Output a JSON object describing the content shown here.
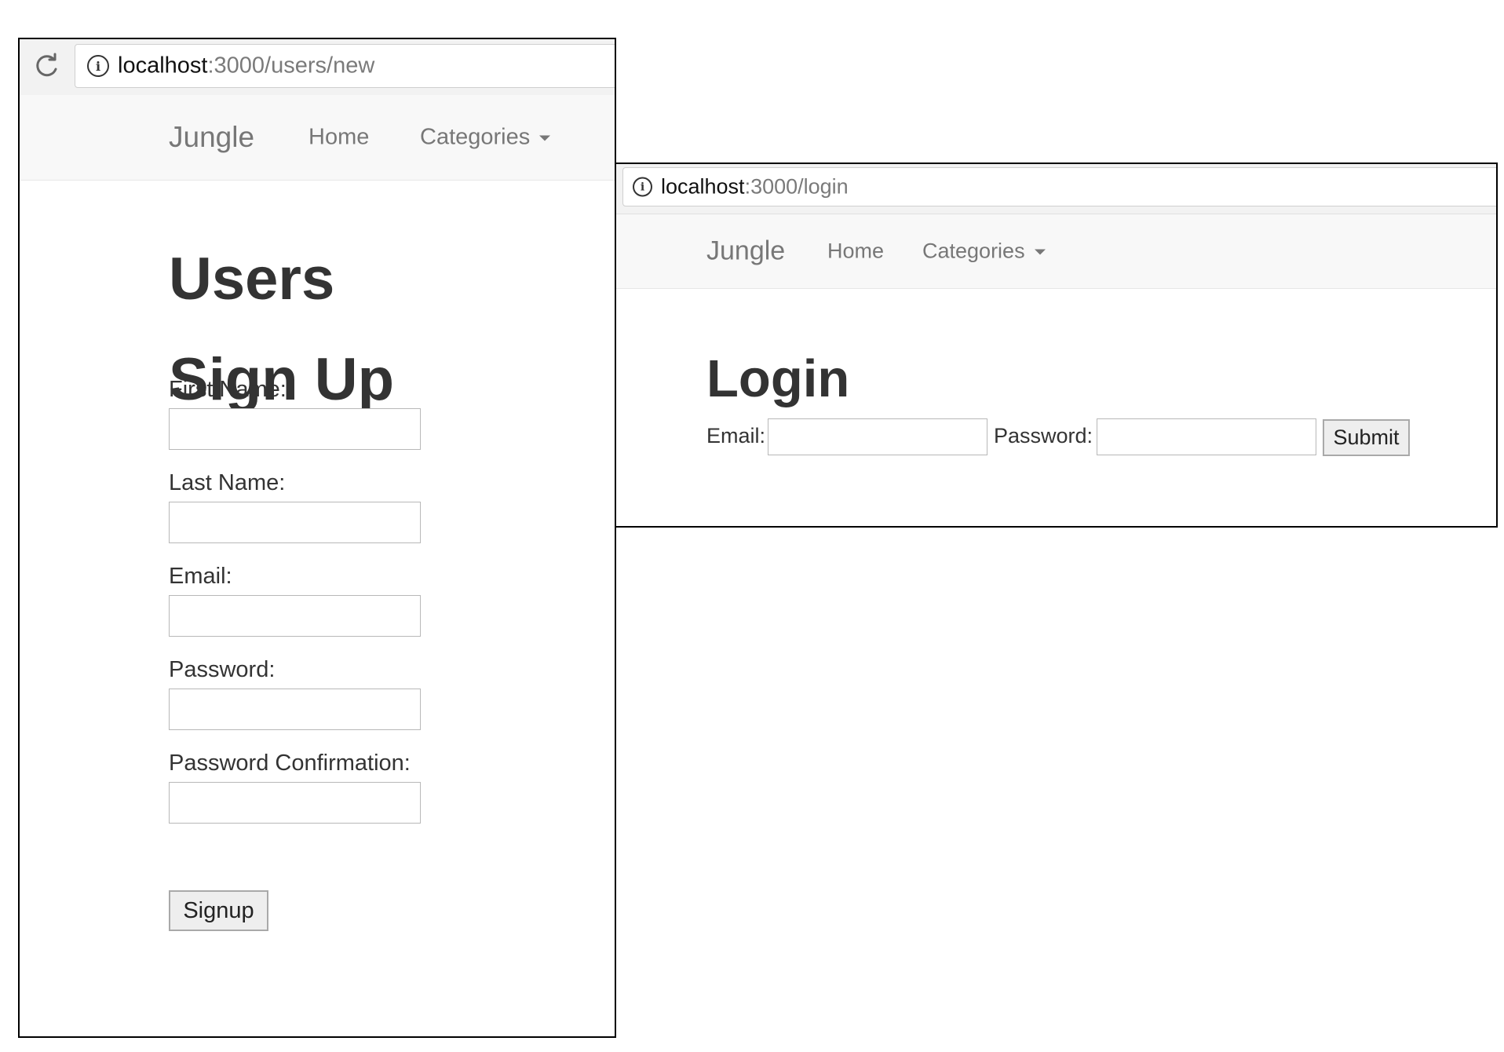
{
  "signup_window": {
    "url_host": "localhost",
    "url_path": ":3000/users/new",
    "nav": {
      "brand": "Jungle",
      "home": "Home",
      "categories": "Categories"
    },
    "title": "Users",
    "subtitle": "Sign Up",
    "fields": [
      {
        "label": "First Name:",
        "value": ""
      },
      {
        "label": "Last Name:",
        "value": ""
      },
      {
        "label": "Email:",
        "value": ""
      },
      {
        "label": "Password:",
        "value": ""
      },
      {
        "label": "Password Confirmation:",
        "value": ""
      }
    ],
    "submit_label": "Signup",
    "icons": {
      "reload": "reload-icon",
      "info": "info-icon",
      "caret": "caret-down-icon"
    }
  },
  "login_window": {
    "url_host": "localhost",
    "url_path": ":3000/login",
    "nav": {
      "brand": "Jungle",
      "home": "Home",
      "categories": "Categories"
    },
    "title": "Login",
    "email_label": "Email:",
    "email_value": "",
    "password_label": "Password:",
    "password_value": "",
    "submit_label": "Submit",
    "icons": {
      "info": "info-icon",
      "caret": "caret-down-icon"
    }
  }
}
